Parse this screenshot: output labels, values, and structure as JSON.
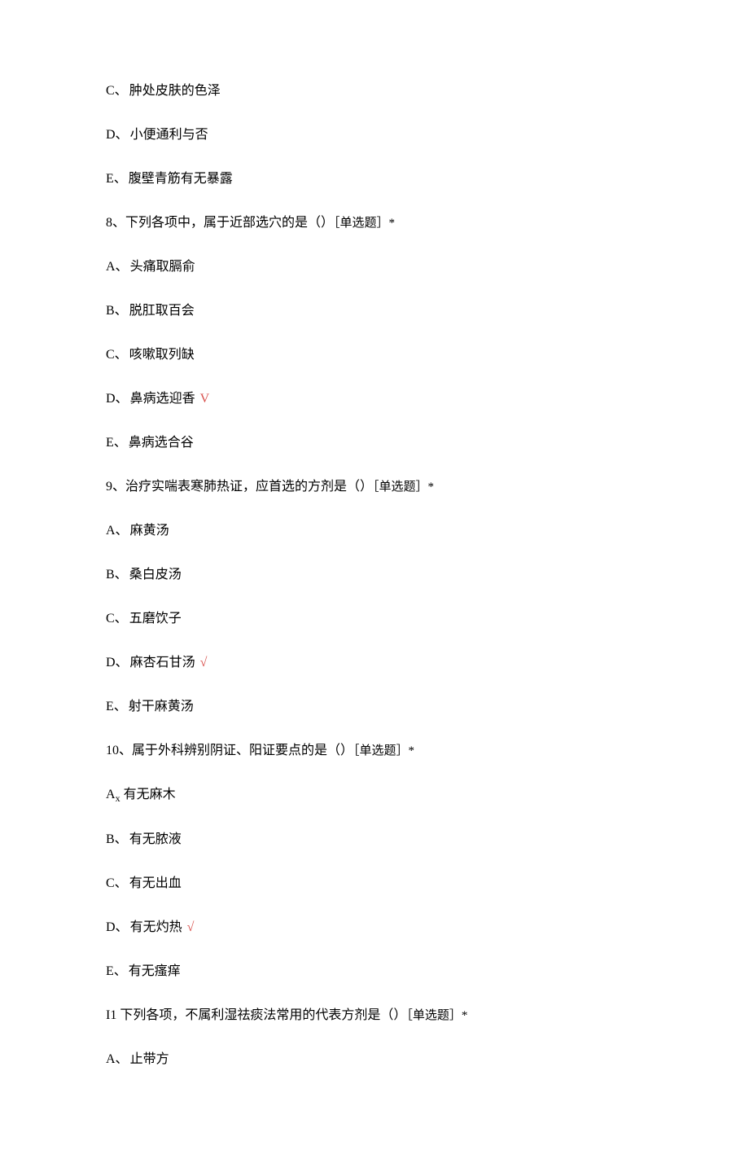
{
  "items": [
    {
      "kind": "option",
      "label": "C、",
      "text": "肿处皮肤的色泽"
    },
    {
      "kind": "option",
      "label": "D、",
      "text": "小便通利与否"
    },
    {
      "kind": "option",
      "label": "E、",
      "text": "腹壁青筋有无暴露"
    },
    {
      "kind": "question",
      "num": "8、",
      "text": "下列各项中，属于近部选穴的是（）",
      "qtype": "［单选题］*"
    },
    {
      "kind": "option",
      "label": "A、",
      "text": "头痛取膈俞"
    },
    {
      "kind": "option",
      "label": "B、",
      "text": "脱肛取百会"
    },
    {
      "kind": "option",
      "label": "C、",
      "text": "咳嗽取列缺"
    },
    {
      "kind": "option",
      "label": "D、",
      "text": "鼻病选迎香",
      "correct": "V"
    },
    {
      "kind": "option",
      "label": "E、",
      "text": "鼻病选合谷"
    },
    {
      "kind": "question",
      "num": "9、",
      "text": "治疗实喘表寒肺热证，应首选的方剂是（）",
      "qtype": "［单选题］*"
    },
    {
      "kind": "option",
      "label": "A、",
      "text": "麻黄汤"
    },
    {
      "kind": "option",
      "label": "B、",
      "text": "桑白皮汤"
    },
    {
      "kind": "option",
      "label": "C、",
      "text": "五磨饮子"
    },
    {
      "kind": "option",
      "label": "D、",
      "text": "麻杏石甘汤",
      "correct": "√"
    },
    {
      "kind": "option",
      "label": "E、",
      "text": "射干麻黄汤"
    },
    {
      "kind": "question",
      "num": "10、",
      "text": "属于外科辨别阴证、阳证要点的是（）",
      "qtype": "［单选题］*"
    },
    {
      "kind": "option-sub",
      "label_main": "A",
      "label_sub": "x",
      "text": "有无麻木"
    },
    {
      "kind": "option",
      "label": "B、",
      "text": "有无脓液"
    },
    {
      "kind": "option",
      "label": "C、",
      "text": "有无出血"
    },
    {
      "kind": "option",
      "label": "D、",
      "text": "有无灼热",
      "correct": "√"
    },
    {
      "kind": "option",
      "label": "E、",
      "text": "有无瘙痒"
    },
    {
      "kind": "question",
      "num": "I1 ",
      "text": "下列各项，不属利湿祛痰法常用的代表方剂是（）",
      "qtype": "［单选题］*"
    },
    {
      "kind": "option",
      "label": "A、",
      "text": "止带方"
    }
  ]
}
